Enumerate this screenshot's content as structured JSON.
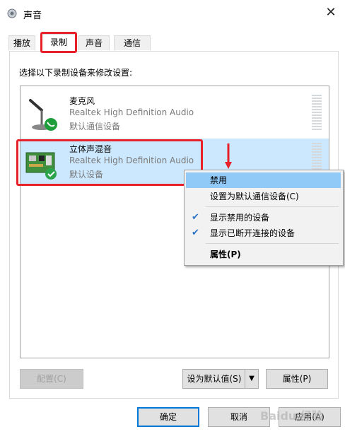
{
  "window": {
    "title": "声音",
    "close_glyph": "✕"
  },
  "tabs": [
    {
      "label": "播放"
    },
    {
      "label": "录制"
    },
    {
      "label": "声音"
    },
    {
      "label": "通信"
    }
  ],
  "instruction": "选择以下录制设备来修改设置:",
  "devices": [
    {
      "name": "麦克风",
      "driver": "Realtek High Definition Audio",
      "status": "默认通信设备",
      "icon": "microphone-icon"
    },
    {
      "name": "立体声混音",
      "driver": "Realtek High Definition Audio",
      "status": "默认设备",
      "icon": "sound-card-icon"
    }
  ],
  "context_menu": {
    "items": [
      {
        "label": "禁用",
        "checked": false
      },
      {
        "label": "设置为默认通信设备(C)",
        "checked": false
      },
      {
        "label": "显示禁用的设备",
        "checked": true
      },
      {
        "label": "显示已断开连接的设备",
        "checked": true
      },
      {
        "label": "属性(P)",
        "checked": false
      }
    ],
    "check_glyph": "✔"
  },
  "buttons": {
    "configure": "配置(C)",
    "set_default": "设为默认值(S)",
    "properties": "属性(P)",
    "ok": "确定",
    "cancel": "取消",
    "apply": "应用(A)",
    "dropdown_glyph": "▼"
  },
  "watermark": "Baidu 经验",
  "colors": {
    "highlight_red": "#e8202a",
    "selection": "#cce8ff",
    "menu_hover": "#91c9f7",
    "accent": "#0078d7"
  }
}
